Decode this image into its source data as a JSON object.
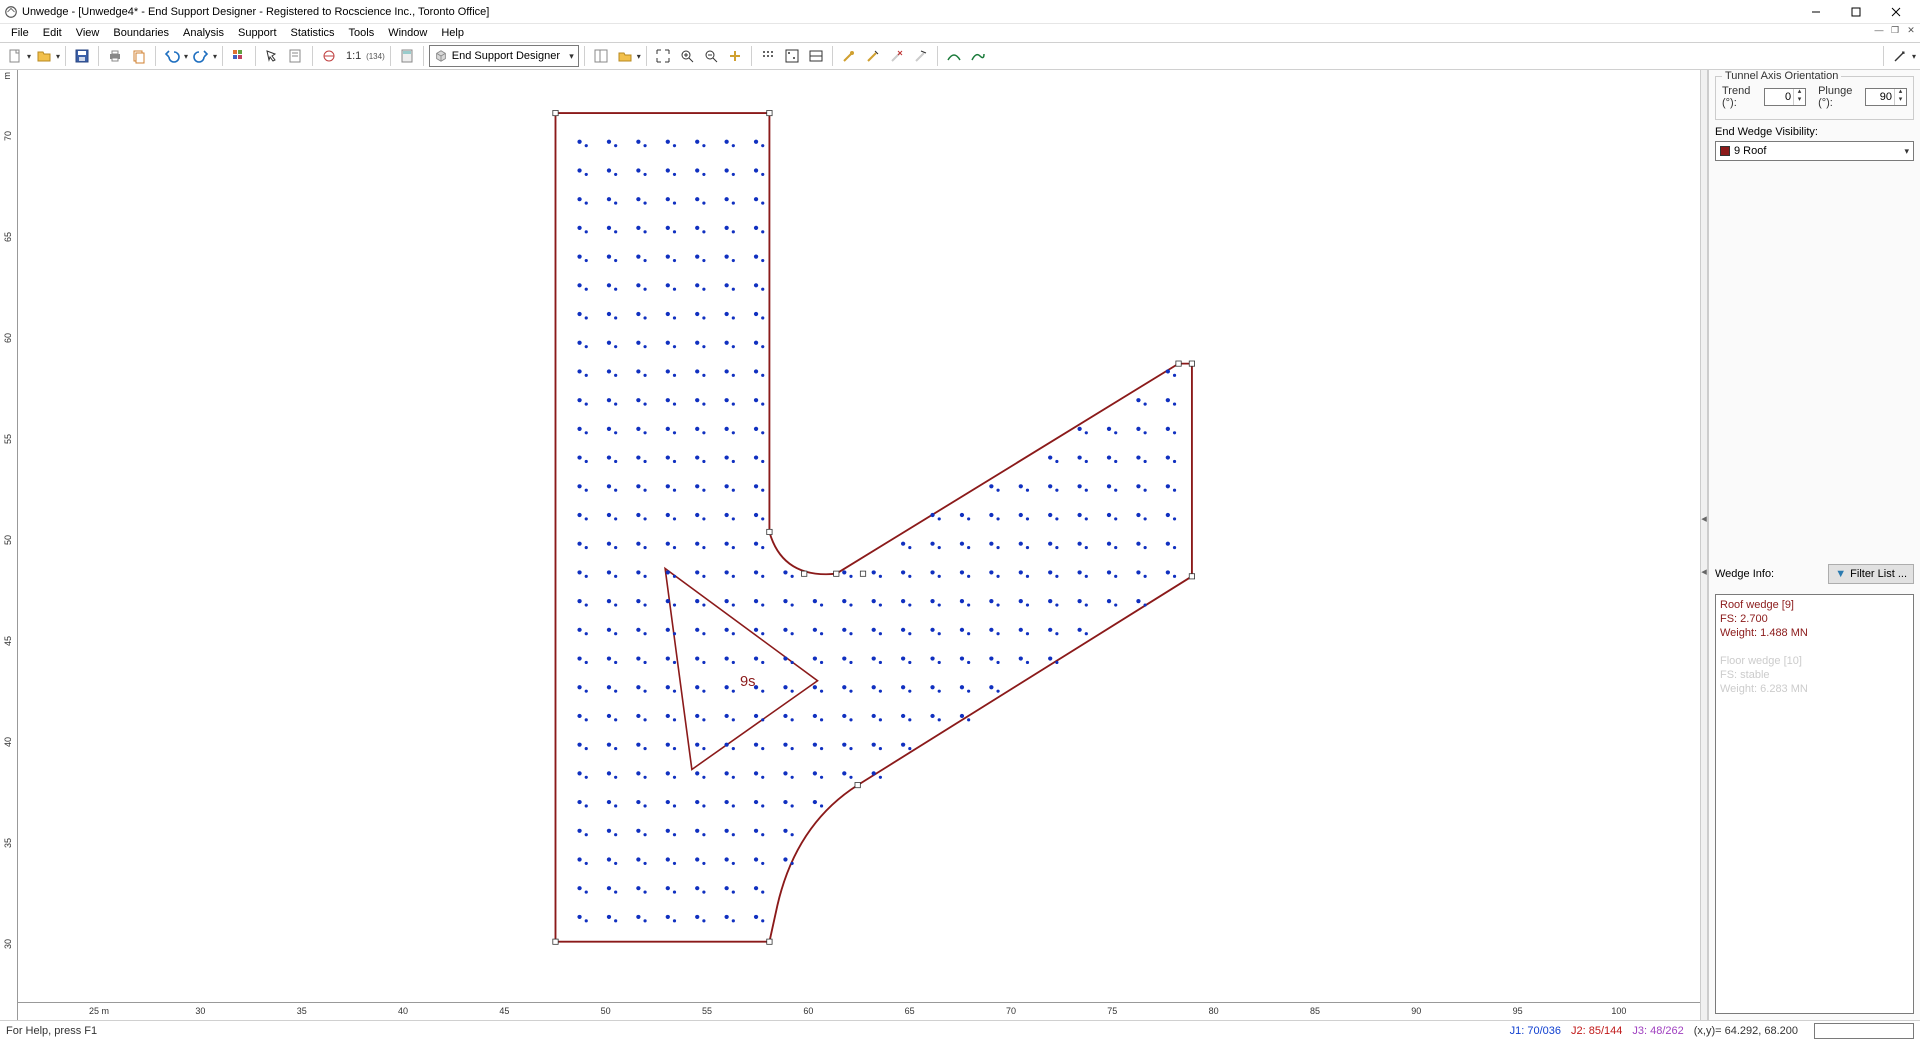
{
  "title": "Unwedge - [Unwedge4* - End Support Designer - Registered to Rocscience Inc., Toronto Office]",
  "menu": [
    "File",
    "Edit",
    "View",
    "Boundaries",
    "Analysis",
    "Support",
    "Statistics",
    "Tools",
    "Window",
    "Help"
  ],
  "viewSelector": {
    "label": "End Support Designer"
  },
  "ruler": {
    "unit": "m",
    "xTicks": [
      "25 m",
      "30",
      "35",
      "40",
      "45",
      "50",
      "55",
      "60",
      "65",
      "70",
      "75",
      "80",
      "85",
      "90",
      "95",
      "100"
    ],
    "yTicks": [
      "30",
      "35",
      "40",
      "45",
      "50",
      "55",
      "60",
      "65",
      "70"
    ]
  },
  "side": {
    "axisGroup": "Tunnel Axis Orientation",
    "trendLabel": "Trend (°):",
    "trendValue": "0",
    "plungeLabel": "Plunge (°):",
    "plungeValue": "90",
    "visLabel": "End Wedge Visibility:",
    "visValue": "9  Roof",
    "wedgeInfoLabel": "Wedge Info:",
    "filterLabel": "Filter List ...",
    "wedges": [
      {
        "l1": "Roof wedge [9]",
        "l2": "FS: 2.700",
        "l3": "Weight: 1.488 MN",
        "cls": "active"
      },
      {
        "l1": "Floor wedge [10]",
        "l2": "FS: stable",
        "l3": "Weight: 6.283 MN",
        "cls": "dim"
      }
    ]
  },
  "status": {
    "help": "For Help, press F1",
    "j1": "J1: 70/036",
    "j2": "J2: 85/144",
    "j3": "J3: 48/262",
    "coord": "(x,y)= 64.292, 68.200"
  },
  "toolbar_scale_label": "(134)",
  "wedge_marker_label": "9s"
}
